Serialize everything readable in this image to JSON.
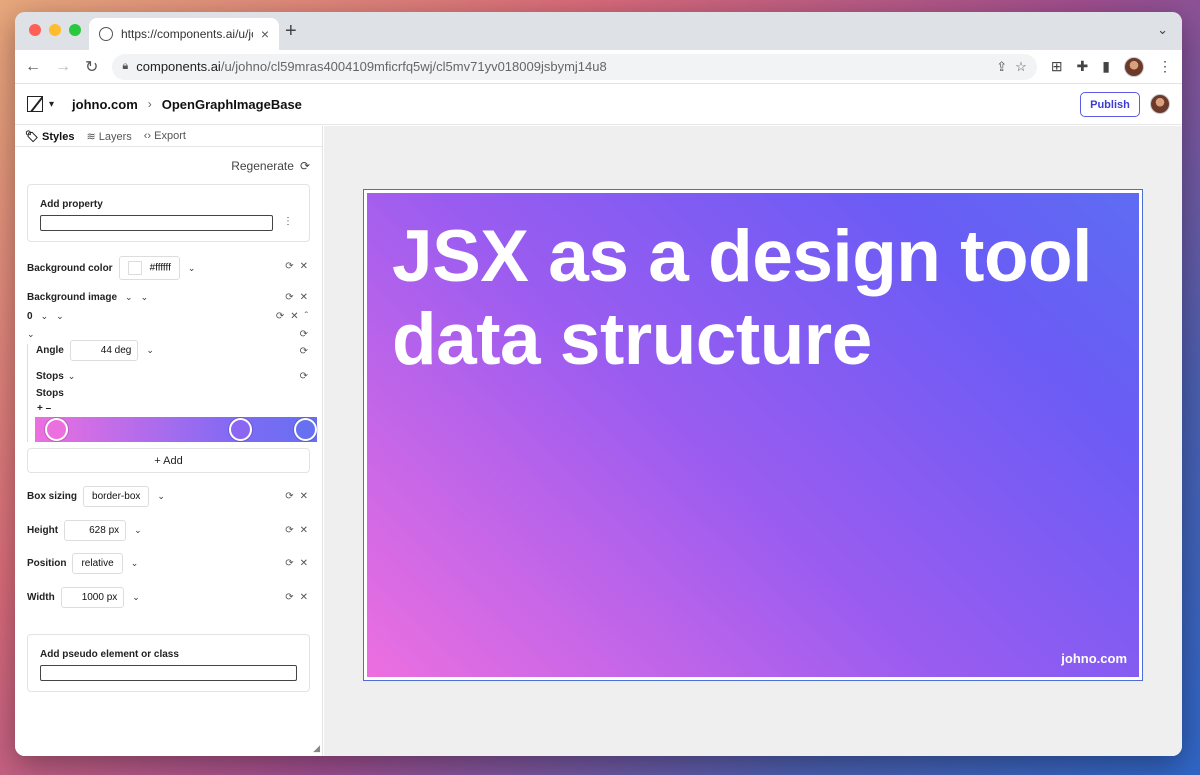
{
  "browser": {
    "tab_title": "https://components.ai/u/johno/",
    "url_host": "components.ai",
    "url_path": "/u/johno/cl59mras4004109mficrfq5wj/cl5mv71yv018009jsbymj14u8"
  },
  "app": {
    "breadcrumb_org": "johno.com",
    "breadcrumb_component": "OpenGraphImageBase",
    "publish_label": "Publish"
  },
  "panel": {
    "tabs": [
      {
        "label": "Styles",
        "icon": "tag-icon"
      },
      {
        "label": "Layers",
        "icon": "layers-icon"
      },
      {
        "label": "Export",
        "icon": "code-icon"
      }
    ],
    "regenerate_label": "Regenerate",
    "add_property_label": "Add property",
    "background_color": {
      "label": "Background color",
      "value": "#ffffff"
    },
    "background_image": {
      "label": "Background image",
      "layer_index": "0"
    },
    "angle": {
      "label": "Angle",
      "value": "44 deg"
    },
    "stops_dropdown_label": "Stops",
    "stops_heading": "Stops",
    "stops_controls": "+ –",
    "gradient_stops": [
      "#ec6fe0",
      "#8a66f2",
      "#6670f0"
    ],
    "add_label": "+ Add",
    "box_sizing": {
      "label": "Box sizing",
      "value": "border-box"
    },
    "height": {
      "label": "Height",
      "value": "628 px"
    },
    "position": {
      "label": "Position",
      "value": "relative"
    },
    "width": {
      "label": "Width",
      "value": "1000 px"
    },
    "pseudo_label": "Add pseudo element or class"
  },
  "preview": {
    "title": "JSX as a design tool data structure",
    "footer": "johno.com"
  },
  "colors": {
    "accent": "#5b5be6",
    "gradient_start": "#ec6fe0",
    "gradient_end": "#5e6cf2"
  }
}
